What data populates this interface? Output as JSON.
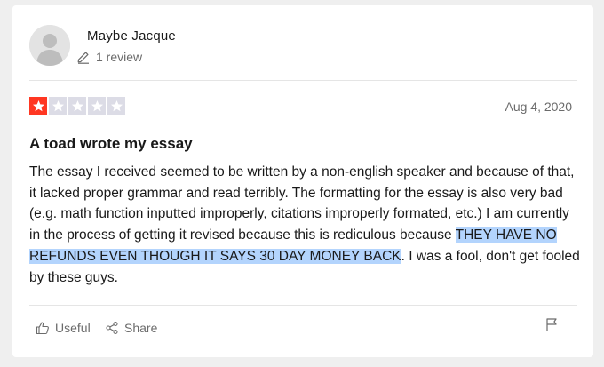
{
  "reviewer": {
    "name": "Maybe Jacque",
    "review_count": "1 review",
    "avatar_icon": "person-silhouette-icon"
  },
  "review": {
    "rating": 1,
    "max_rating": 5,
    "date": "Aug 4, 2020",
    "title": "A toad wrote my essay",
    "body_before_selection": "The essay I received seemed to be written by a non-english speaker and because of that, it lacked proper grammar and read terribly. The formatting for the essay is also very bad (e.g. math function inputted improperly, citations improperly formated, etc.) I am currently in the process of getting it revised because this is rediculous because ",
    "body_selected": "THEY HAVE NO REFUNDS EVEN THOUGH IT SAYS 30 DAY MONEY BACK",
    "body_after_selection": ". I was a fool, don't get fooled by these guys."
  },
  "actions": {
    "useful_label": "Useful",
    "share_label": "Share"
  },
  "colors": {
    "star_filled": "#ff3722",
    "star_empty": "#dcdce6",
    "selection_highlight": "#b3d4fd",
    "muted_text": "#6b6b6b"
  }
}
